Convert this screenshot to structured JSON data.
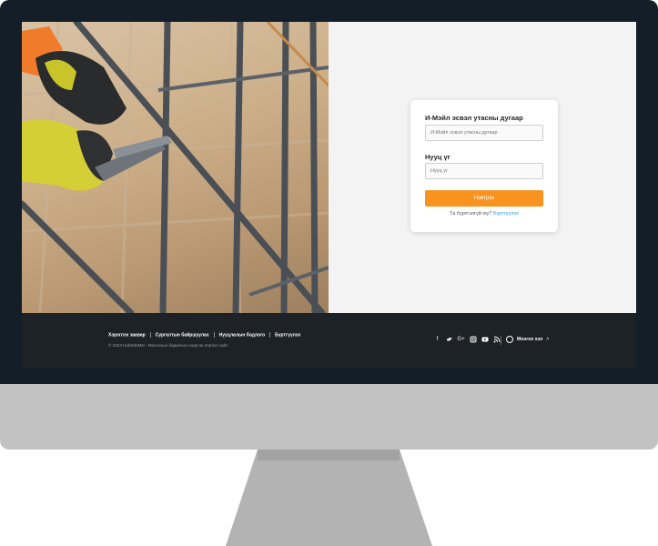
{
  "login": {
    "email_label": "И-Мэйл эсвэл утасны дугаар",
    "email_placeholder": "И-Мэйл эсвэл утасны дугаар",
    "password_label": "Нууц үг",
    "password_placeholder": "Нууц үг",
    "submit_label": "Нэвтрэх",
    "register_prompt": "Та бүртгэлгүй юу?",
    "register_link": "Бүртгүүлэх"
  },
  "footer": {
    "links": [
      "Хэрэглэх заавар",
      "Сургалтын байршуулах",
      "Нууцлалын бодлого",
      "Бүртгүүлэх"
    ],
    "copyright": "© 2023 HubSiteMN - Монголын барилгын нэгдсэн портал сайт.",
    "social_icons": [
      "facebook-icon",
      "twitter-icon",
      "google-plus-icon",
      "instagram-icon",
      "youtube-icon",
      "rss-icon"
    ],
    "language": "Монгол хэл"
  },
  "colors": {
    "accent": "#f7931e",
    "link": "#3a9bd9",
    "bezel": "#141e28",
    "footer": "#1d2226"
  }
}
